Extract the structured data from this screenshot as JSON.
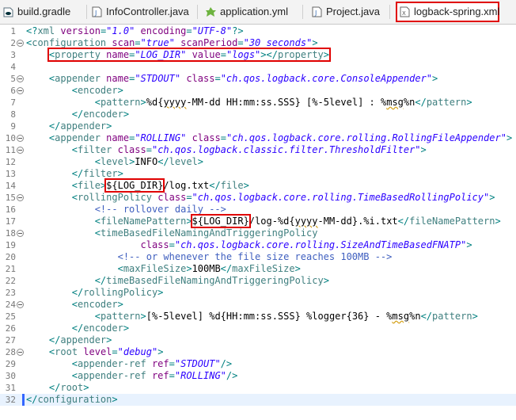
{
  "tabs": [
    {
      "label": "build.gradle",
      "icon": "gradle-file-icon",
      "active": false
    },
    {
      "label": "InfoController.java",
      "icon": "java-file-icon",
      "active": false
    },
    {
      "label": "application.yml",
      "icon": "yml-file-icon",
      "active": false
    },
    {
      "label": "Project.java",
      "icon": "java-file-icon",
      "active": false
    },
    {
      "label": "logback-spring.xml",
      "icon": "xml-file-icon",
      "active": true
    }
  ],
  "lines": [
    {
      "n": "1",
      "fold": false,
      "segs": [
        [
          "p",
          "<?"
        ],
        [
          "t",
          "xml "
        ],
        [
          "a",
          "version"
        ],
        [
          "p",
          "="
        ],
        [
          "v",
          "\"1.0\""
        ],
        [
          "a",
          " encoding"
        ],
        [
          "p",
          "="
        ],
        [
          "v",
          "\"UTF-8\""
        ],
        [
          "p",
          "?>"
        ]
      ]
    },
    {
      "n": "2",
      "fold": true,
      "segs": [
        [
          "p",
          "<"
        ],
        [
          "t",
          "configuration "
        ],
        [
          "a",
          "scan"
        ],
        [
          "p",
          "="
        ],
        [
          "v",
          "\"true\""
        ],
        [
          "a",
          " scanPeriod"
        ],
        [
          "p",
          "="
        ],
        [
          "v",
          "\"30 seconds\""
        ],
        [
          "p",
          ">"
        ]
      ]
    },
    {
      "n": "3",
      "fold": false,
      "segs": [
        [
          "x",
          "    "
        ],
        [
          "box_open",
          ""
        ],
        [
          "p",
          "<"
        ],
        [
          "t",
          "property "
        ],
        [
          "a",
          "name"
        ],
        [
          "p",
          "="
        ],
        [
          "v",
          "\"LOG_DIR\""
        ],
        [
          "a",
          " value"
        ],
        [
          "p",
          "="
        ],
        [
          "v",
          "\"logs\""
        ],
        [
          "p",
          "></"
        ],
        [
          "t",
          "property"
        ],
        [
          "p",
          ">"
        ],
        [
          "box_close",
          ""
        ]
      ]
    },
    {
      "n": "4",
      "fold": false,
      "segs": []
    },
    {
      "n": "5",
      "fold": true,
      "segs": [
        [
          "x",
          "    "
        ],
        [
          "p",
          "<"
        ],
        [
          "t",
          "appender "
        ],
        [
          "a",
          "name"
        ],
        [
          "p",
          "="
        ],
        [
          "v",
          "\"STDOUT\""
        ],
        [
          "a",
          " class"
        ],
        [
          "p",
          "="
        ],
        [
          "v",
          "\"ch.qos.logback.core.ConsoleAppender\""
        ],
        [
          "p",
          ">"
        ]
      ]
    },
    {
      "n": "6",
      "fold": true,
      "segs": [
        [
          "x",
          "        "
        ],
        [
          "p",
          "<"
        ],
        [
          "t",
          "encoder"
        ],
        [
          "p",
          ">"
        ]
      ]
    },
    {
      "n": "7",
      "fold": false,
      "segs": [
        [
          "x",
          "            "
        ],
        [
          "p",
          "<"
        ],
        [
          "t",
          "pattern"
        ],
        [
          "p",
          ">"
        ],
        [
          "x",
          "%d{"
        ],
        [
          "sq",
          "yyyy"
        ],
        [
          "x",
          "-MM-dd HH:mm:ss.SSS} [%-5level] : %"
        ],
        [
          "sq",
          "msg"
        ],
        [
          "x",
          "%n"
        ],
        [
          "p",
          "</"
        ],
        [
          "t",
          "pattern"
        ],
        [
          "p",
          ">"
        ]
      ]
    },
    {
      "n": "8",
      "fold": false,
      "segs": [
        [
          "x",
          "        "
        ],
        [
          "p",
          "</"
        ],
        [
          "t",
          "encoder"
        ],
        [
          "p",
          ">"
        ]
      ]
    },
    {
      "n": "9",
      "fold": false,
      "segs": [
        [
          "x",
          "    "
        ],
        [
          "p",
          "</"
        ],
        [
          "t",
          "appender"
        ],
        [
          "p",
          ">"
        ]
      ]
    },
    {
      "n": "10",
      "fold": true,
      "segs": [
        [
          "x",
          "    "
        ],
        [
          "p",
          "<"
        ],
        [
          "t",
          "appender "
        ],
        [
          "a",
          "name"
        ],
        [
          "p",
          "="
        ],
        [
          "v",
          "\"ROLLING\""
        ],
        [
          "a",
          " class"
        ],
        [
          "p",
          "="
        ],
        [
          "v",
          "\"ch.qos.logback.core.rolling.RollingFileAppender\""
        ],
        [
          "p",
          ">"
        ]
      ]
    },
    {
      "n": "11",
      "fold": true,
      "segs": [
        [
          "x",
          "        "
        ],
        [
          "p",
          "<"
        ],
        [
          "t",
          "filter "
        ],
        [
          "a",
          "class"
        ],
        [
          "p",
          "="
        ],
        [
          "v",
          "\"ch.qos.logback.classic.filter.ThresholdFilter\""
        ],
        [
          "p",
          ">"
        ]
      ]
    },
    {
      "n": "12",
      "fold": false,
      "segs": [
        [
          "x",
          "            "
        ],
        [
          "p",
          "<"
        ],
        [
          "t",
          "level"
        ],
        [
          "p",
          ">"
        ],
        [
          "x",
          "INFO"
        ],
        [
          "p",
          "</"
        ],
        [
          "t",
          "level"
        ],
        [
          "p",
          ">"
        ]
      ]
    },
    {
      "n": "13",
      "fold": false,
      "segs": [
        [
          "x",
          "        "
        ],
        [
          "p",
          "</"
        ],
        [
          "t",
          "filter"
        ],
        [
          "p",
          ">"
        ]
      ]
    },
    {
      "n": "14",
      "fold": false,
      "segs": [
        [
          "x",
          "        "
        ],
        [
          "p",
          "<"
        ],
        [
          "t",
          "file"
        ],
        [
          "p",
          ">"
        ],
        [
          "box_open",
          ""
        ],
        [
          "x",
          "${LOG_DIR}"
        ],
        [
          "box_close",
          ""
        ],
        [
          "x",
          "/log.txt"
        ],
        [
          "p",
          "</"
        ],
        [
          "t",
          "file"
        ],
        [
          "p",
          ">"
        ]
      ]
    },
    {
      "n": "15",
      "fold": true,
      "segs": [
        [
          "x",
          "        "
        ],
        [
          "p",
          "<"
        ],
        [
          "t",
          "rollingPolicy "
        ],
        [
          "a",
          "class"
        ],
        [
          "p",
          "="
        ],
        [
          "v",
          "\"ch.qos.logback.core.rolling.TimeBasedRollingPolicy\""
        ],
        [
          "p",
          ">"
        ]
      ]
    },
    {
      "n": "16",
      "fold": false,
      "segs": [
        [
          "x",
          "            "
        ],
        [
          "c",
          "<!-- rollover daily -->"
        ]
      ]
    },
    {
      "n": "17",
      "fold": false,
      "segs": [
        [
          "x",
          "            "
        ],
        [
          "p",
          "<"
        ],
        [
          "t",
          "fileNamePattern"
        ],
        [
          "p",
          ">"
        ],
        [
          "box_open",
          ""
        ],
        [
          "x",
          "${LOG_DIR}"
        ],
        [
          "box_close",
          ""
        ],
        [
          "x",
          "/log-%d{"
        ],
        [
          "sq",
          "yyyy"
        ],
        [
          "x",
          "-MM-dd}.%i.txt"
        ],
        [
          "p",
          "</"
        ],
        [
          "t",
          "fileNamePattern"
        ],
        [
          "p",
          ">"
        ]
      ]
    },
    {
      "n": "18",
      "fold": true,
      "segs": [
        [
          "x",
          "            "
        ],
        [
          "p",
          "<"
        ],
        [
          "t",
          "timeBasedFileNamingAndTriggeringPolicy"
        ]
      ]
    },
    {
      "n": "19",
      "fold": false,
      "segs": [
        [
          "x",
          "                    "
        ],
        [
          "a",
          "class"
        ],
        [
          "p",
          "="
        ],
        [
          "v",
          "\"ch.qos.logback.core.rolling.SizeAndTimeBasedFNATP\""
        ],
        [
          "p",
          ">"
        ]
      ]
    },
    {
      "n": "20",
      "fold": false,
      "segs": [
        [
          "x",
          "                "
        ],
        [
          "c",
          "<!-- or whenever the file size reaches 100MB -->"
        ]
      ]
    },
    {
      "n": "21",
      "fold": false,
      "segs": [
        [
          "x",
          "                "
        ],
        [
          "p",
          "<"
        ],
        [
          "t",
          "maxFileSize"
        ],
        [
          "p",
          ">"
        ],
        [
          "x",
          "100MB"
        ],
        [
          "p",
          "</"
        ],
        [
          "t",
          "maxFileSize"
        ],
        [
          "p",
          ">"
        ]
      ]
    },
    {
      "n": "22",
      "fold": false,
      "segs": [
        [
          "x",
          "            "
        ],
        [
          "p",
          "</"
        ],
        [
          "t",
          "timeBasedFileNamingAndTriggeringPolicy"
        ],
        [
          "p",
          ">"
        ]
      ]
    },
    {
      "n": "23",
      "fold": false,
      "segs": [
        [
          "x",
          "        "
        ],
        [
          "p",
          "</"
        ],
        [
          "t",
          "rollingPolicy"
        ],
        [
          "p",
          ">"
        ]
      ]
    },
    {
      "n": "24",
      "fold": true,
      "segs": [
        [
          "x",
          "        "
        ],
        [
          "p",
          "<"
        ],
        [
          "t",
          "encoder"
        ],
        [
          "p",
          ">"
        ]
      ]
    },
    {
      "n": "25",
      "fold": false,
      "segs": [
        [
          "x",
          "            "
        ],
        [
          "p",
          "<"
        ],
        [
          "t",
          "pattern"
        ],
        [
          "p",
          ">"
        ],
        [
          "x",
          "[%-5level] %d{HH:mm:ss.SSS} %logger{36} - %"
        ],
        [
          "sq",
          "msg"
        ],
        [
          "x",
          "%n"
        ],
        [
          "p",
          "</"
        ],
        [
          "t",
          "pattern"
        ],
        [
          "p",
          ">"
        ]
      ]
    },
    {
      "n": "26",
      "fold": false,
      "segs": [
        [
          "x",
          "        "
        ],
        [
          "p",
          "</"
        ],
        [
          "t",
          "encoder"
        ],
        [
          "p",
          ">"
        ]
      ]
    },
    {
      "n": "27",
      "fold": false,
      "segs": [
        [
          "x",
          "    "
        ],
        [
          "p",
          "</"
        ],
        [
          "t",
          "appender"
        ],
        [
          "p",
          ">"
        ]
      ]
    },
    {
      "n": "28",
      "fold": true,
      "segs": [
        [
          "x",
          "    "
        ],
        [
          "p",
          "<"
        ],
        [
          "t",
          "root "
        ],
        [
          "a",
          "level"
        ],
        [
          "p",
          "="
        ],
        [
          "v",
          "\"debug\""
        ],
        [
          "p",
          ">"
        ]
      ]
    },
    {
      "n": "29",
      "fold": false,
      "segs": [
        [
          "x",
          "        "
        ],
        [
          "p",
          "<"
        ],
        [
          "t",
          "appender-ref "
        ],
        [
          "a",
          "ref"
        ],
        [
          "p",
          "="
        ],
        [
          "v",
          "\"STDOUT\""
        ],
        [
          "p",
          "/>"
        ]
      ]
    },
    {
      "n": "30",
      "fold": false,
      "segs": [
        [
          "x",
          "        "
        ],
        [
          "p",
          "<"
        ],
        [
          "t",
          "appender-ref "
        ],
        [
          "a",
          "ref"
        ],
        [
          "p",
          "="
        ],
        [
          "v",
          "\"ROLLING\""
        ],
        [
          "p",
          "/>"
        ]
      ]
    },
    {
      "n": "31",
      "fold": false,
      "segs": [
        [
          "x",
          "    "
        ],
        [
          "p",
          "</"
        ],
        [
          "t",
          "root"
        ],
        [
          "p",
          ">"
        ]
      ]
    },
    {
      "n": "32",
      "fold": false,
      "current": true,
      "segs": [
        [
          "p",
          "</"
        ],
        [
          "t",
          "configuration"
        ],
        [
          "p",
          ">"
        ]
      ]
    }
  ]
}
